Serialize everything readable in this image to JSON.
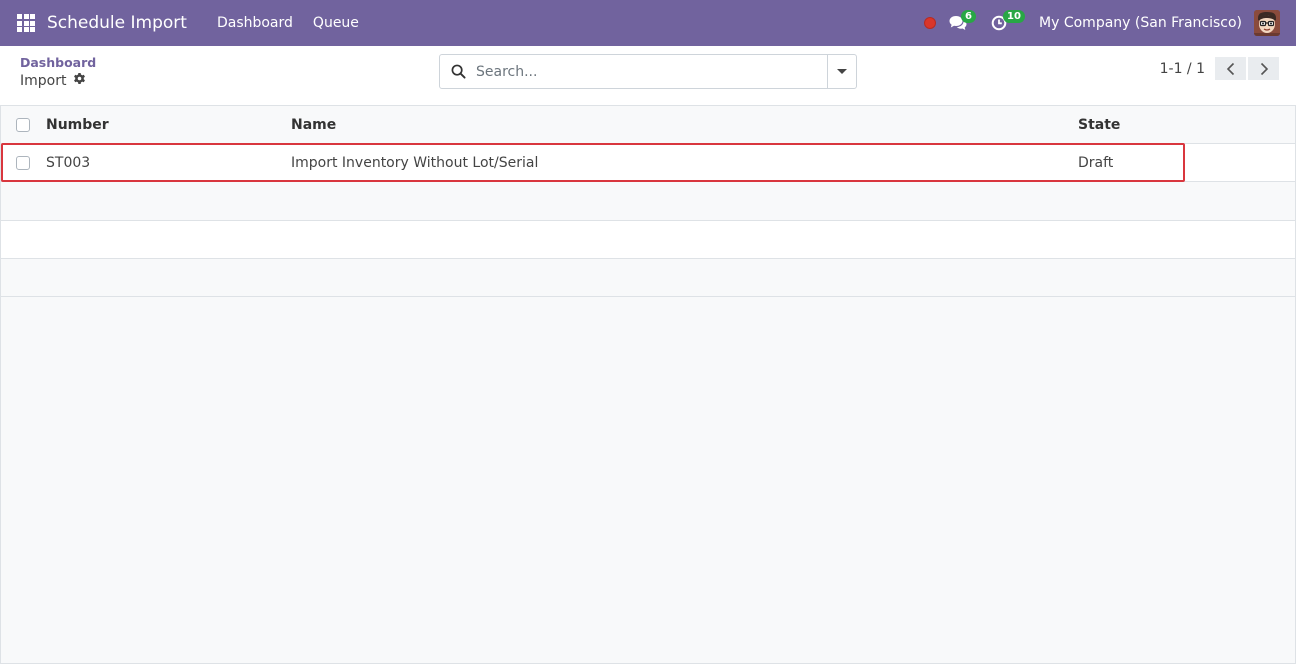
{
  "brand_color": "#71639e",
  "navbar": {
    "app_title": "Schedule Import",
    "menu": [
      {
        "label": "Dashboard"
      },
      {
        "label": "Queue"
      }
    ],
    "messages_badge": "6",
    "activities_badge": "10",
    "company": "My Company (San Francisco)"
  },
  "control_panel": {
    "breadcrumb_parent": "Dashboard",
    "breadcrumb_current": "Import",
    "search_placeholder": "Search...",
    "pager_value": "1-1 / 1"
  },
  "list": {
    "columns": {
      "number": "Number",
      "name": "Name",
      "state": "State"
    },
    "rows": [
      {
        "number": "ST003",
        "name": "Import Inventory Without Lot/Serial",
        "state": "Draft"
      }
    ]
  }
}
